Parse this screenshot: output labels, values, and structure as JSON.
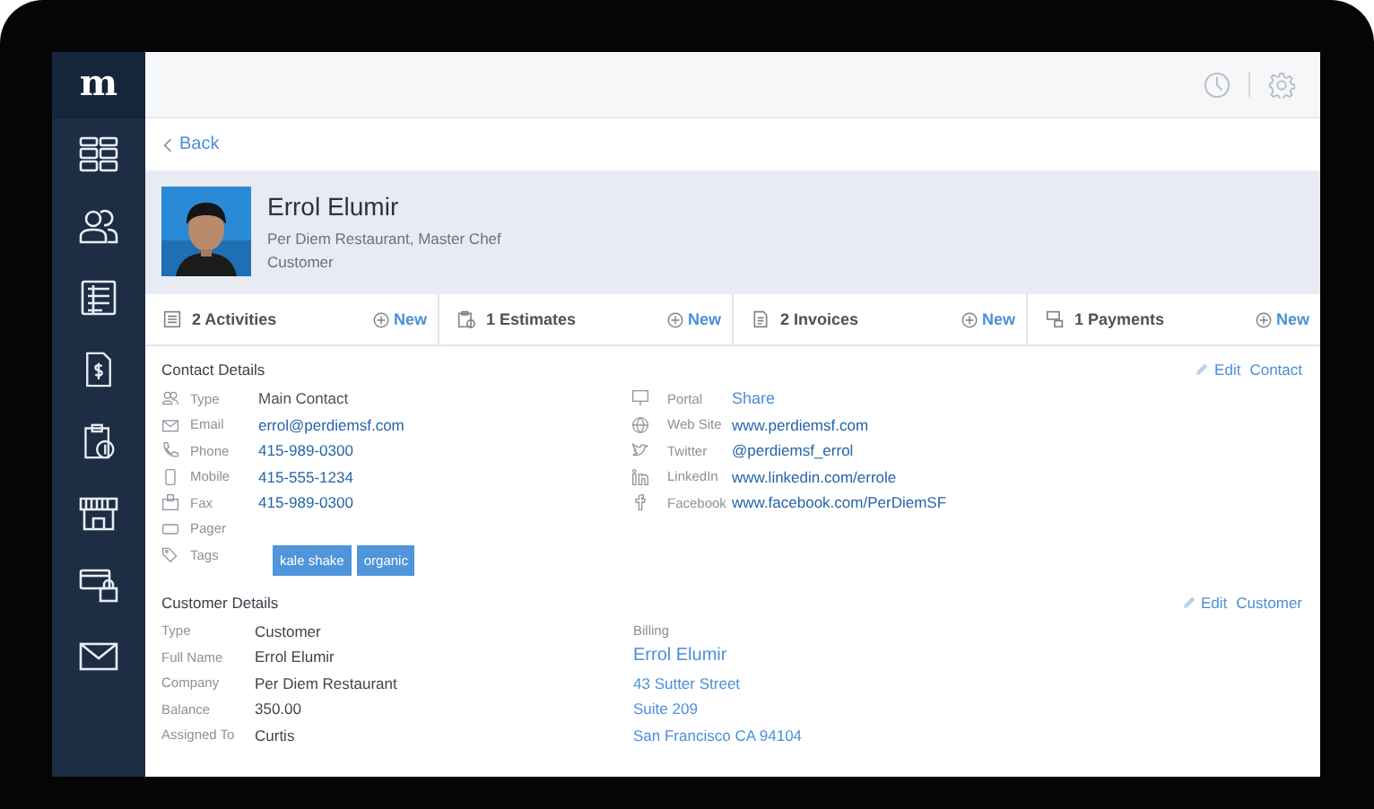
{
  "sidebar": {
    "logo": "m"
  },
  "back": {
    "label": "Back"
  },
  "profile": {
    "name": "Errol Elumir",
    "subtitle": "Per Diem Restaurant, Master Chef",
    "role": "Customer"
  },
  "tabs": [
    {
      "label": "2 Activities",
      "action": "New"
    },
    {
      "label": "1 Estimates",
      "action": "New"
    },
    {
      "label": "2 Invoices",
      "action": "New"
    },
    {
      "label": "1 Payments",
      "action": "New"
    }
  ],
  "contact_details": {
    "title": "Contact Details",
    "edit": "Edit",
    "edit_target": "Contact",
    "left": [
      {
        "label": "Type",
        "value": "Main Contact",
        "kind": "text"
      },
      {
        "label": "Email",
        "value": "errol@perdiemsf.com",
        "kind": "link"
      },
      {
        "label": "Phone",
        "value": "415-989-0300",
        "kind": "link"
      },
      {
        "label": "Mobile",
        "value": "415-555-1234",
        "kind": "link"
      },
      {
        "label": "Fax",
        "value": "415-989-0300",
        "kind": "link"
      },
      {
        "label": "Pager",
        "kind": "empty"
      },
      {
        "label": "Tags",
        "kind": "tags",
        "tags": [
          "kale shake",
          "organic"
        ]
      }
    ],
    "right": [
      {
        "label": "Portal",
        "value": "Share",
        "kind": "action"
      },
      {
        "label": "Web Site",
        "value": "www.perdiemsf.com",
        "kind": "link"
      },
      {
        "label": "Twitter",
        "value": "@perdiemsf_errol",
        "kind": "link"
      },
      {
        "label": "LinkedIn",
        "value": "www.linkedin.com/errole",
        "kind": "link"
      },
      {
        "label": "Facebook",
        "value": "www.facebook.com/PerDiemSF",
        "kind": "link"
      }
    ]
  },
  "customer_details": {
    "title": "Customer Details",
    "edit": "Edit",
    "edit_target": "Customer",
    "fields": [
      {
        "label": "Type",
        "value": "Customer"
      },
      {
        "label": "Full Name",
        "value": "Errol Elumir"
      },
      {
        "label": "Company",
        "value": "Per Diem Restaurant"
      },
      {
        "label": "Balance",
        "value": "350.00"
      },
      {
        "label": "Assigned To",
        "value": "Curtis"
      }
    ],
    "billing": {
      "label": "Billing",
      "lines": [
        "Errol Elumir",
        "43 Sutter Street",
        "Suite 209",
        "San Francisco CA 94104"
      ]
    }
  }
}
